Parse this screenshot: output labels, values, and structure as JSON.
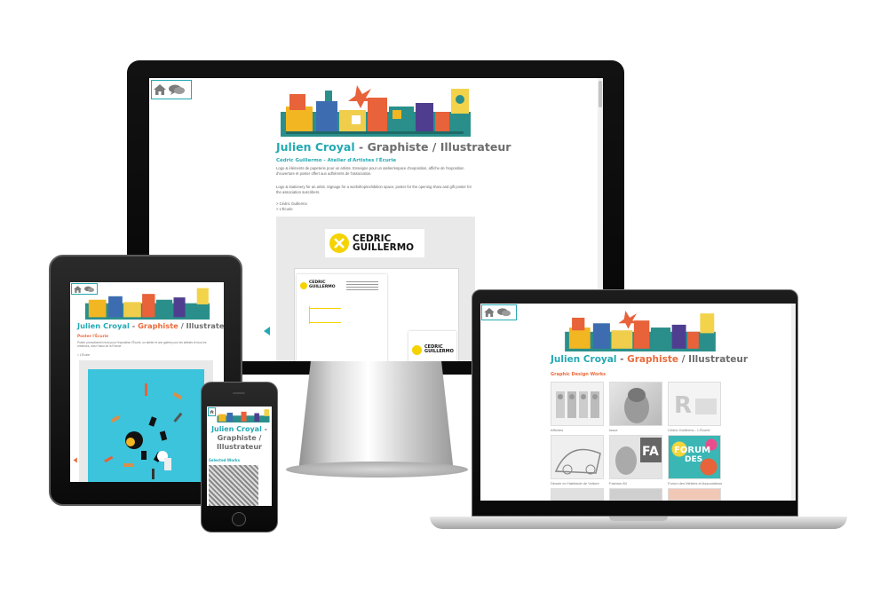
{
  "site": {
    "name_first": "Julien Croyal",
    "dash": " - ",
    "role_graphiste": "Graphiste",
    "slash": " / ",
    "role_illustrateur": "Illustrateur"
  },
  "imac": {
    "project_title": "Cédric Guillermo - Atelier d'Artistes l'Écurie",
    "desc_fr": "Logo & éléments de papeterie pour un artiste. Enseigne pour un atelier/espace d'exposition, affiche de l'exposition d'ouverture et poster offert aux adhérents de l'association.",
    "desc_en": "Logo & stationery for an artist. Signage for a workshop/exhibition space, poster for the opening show and gift poster for the association suscribers.",
    "link1": "> Cédric Guillermo",
    "link2": "> L'Écurie",
    "logo_line1": "CEDRIC",
    "logo_line2": "GUILLERMO",
    "card_logo_line1": "CEDRIC",
    "card_logo_line2": "GUILLERMO"
  },
  "tablet": {
    "project_title": "Poster l'Écurie",
    "desc": "Poster promotionnel recto pour l'exposition l'Écurie, un atelier et une galerie pour les artistes et tous les créateurs, chez l'asso de la France.",
    "link": "> L'Écurie"
  },
  "phone": {
    "title_line1": "Julien Croyal",
    "title_dash": " -",
    "title_line2": "Graphiste /",
    "title_line3": "Illustrateur",
    "section": "Selected Works"
  },
  "laptop": {
    "section": "Graphic Design Works",
    "thumbs": [
      {
        "label": "Affiches"
      },
      {
        "label": "Issue"
      },
      {
        "label": "Cédric Guillermo - L'Écurie"
      },
      {
        "label": "Dessin en Habitacle de Voiture"
      },
      {
        "label": "Fashion AV"
      },
      {
        "label": "Forum des Métiers et Associations"
      }
    ],
    "forum_text1": "FORUM",
    "forum_text2": "DES",
    "fa_text": "FA"
  },
  "colors": {
    "teal": "#24a9b3",
    "orange": "#ea6b3c",
    "grey_text": "#6d6d6d",
    "logo_yellow": "#f5d300"
  },
  "icons": [
    "home-icon",
    "chat-icon",
    "prev-arrow-icon"
  ]
}
